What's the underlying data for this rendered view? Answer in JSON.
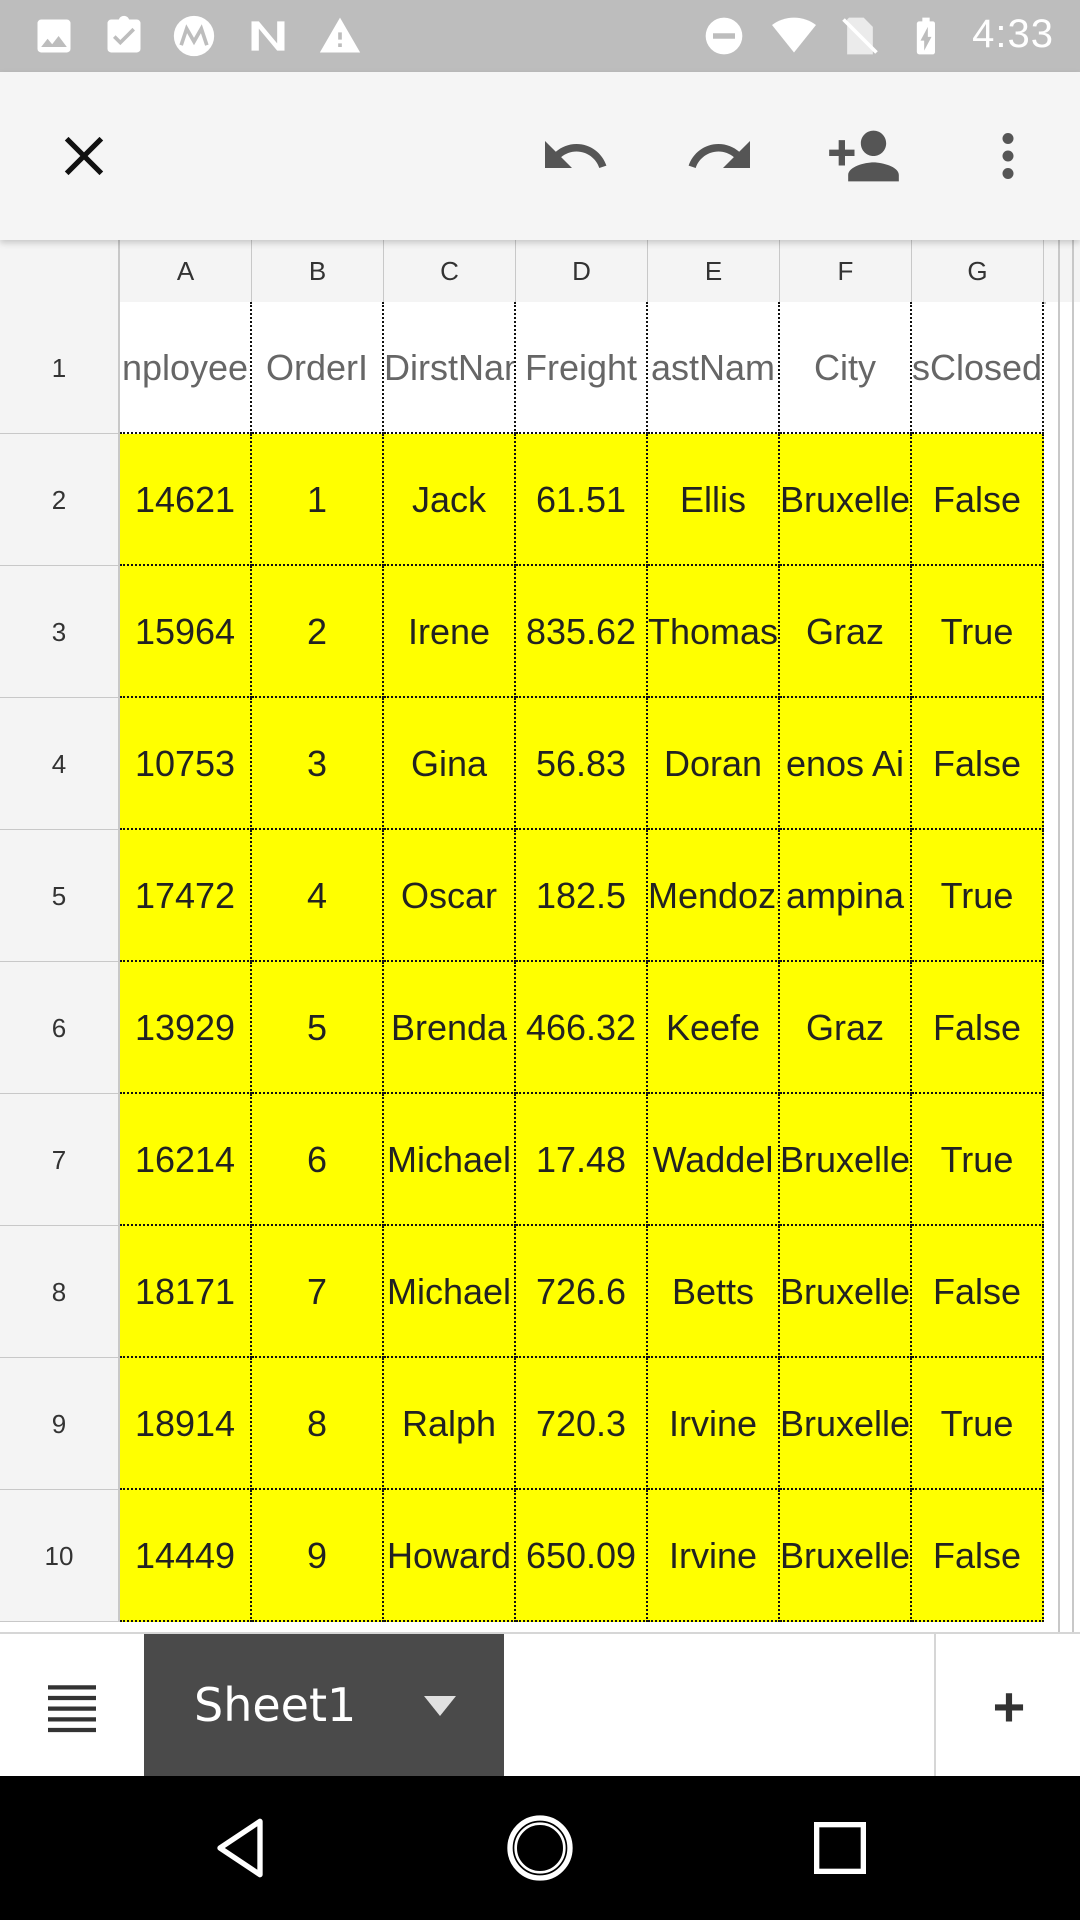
{
  "status_bar": {
    "time": "4:33",
    "left_icons": [
      "photo-icon",
      "clipboard-check-icon",
      "motorola-icon",
      "n-icon",
      "warning-icon"
    ],
    "right_icons": [
      "do-not-disturb-icon",
      "wifi-icon",
      "no-sim-icon",
      "battery-charging-icon"
    ]
  },
  "toolbar": {
    "icons": [
      "close-icon",
      "undo-icon",
      "redo-icon",
      "add-person-icon",
      "more-vert-icon"
    ]
  },
  "columns": [
    "A",
    "B",
    "C",
    "D",
    "E",
    "F",
    "G"
  ],
  "row_numbers": [
    "1",
    "2",
    "3",
    "4",
    "5",
    "6",
    "7",
    "8",
    "9",
    "10"
  ],
  "header_row": [
    "nployee",
    "OrderI",
    "DirstNam",
    "Freight",
    "astNam",
    "City",
    "sClosed"
  ],
  "rows": [
    [
      "14621",
      "1",
      "Jack",
      "61.51",
      "Ellis",
      "Bruxelles",
      "False"
    ],
    [
      "15964",
      "2",
      "Irene",
      "835.62",
      "Thomas",
      "Graz",
      "True"
    ],
    [
      "10753",
      "3",
      "Gina",
      "56.83",
      "Doran",
      "enos Ai",
      "False"
    ],
    [
      "17472",
      "4",
      "Oscar",
      "182.5",
      "Mendoza",
      "ampina",
      "True"
    ],
    [
      "13929",
      "5",
      "Brenda",
      "466.32",
      "Keefe",
      "Graz",
      "False"
    ],
    [
      "16214",
      "6",
      "Michael",
      "17.48",
      "Waddel",
      "Bruxelles",
      "True"
    ],
    [
      "18171",
      "7",
      "Michael",
      "726.6",
      "Betts",
      "Bruxelles",
      "False"
    ],
    [
      "18914",
      "8",
      "Ralph",
      "720.3",
      "Irvine",
      "Bruxelles",
      "True"
    ],
    [
      "14449",
      "9",
      "Howard",
      "650.09",
      "Irvine",
      "Bruxelles",
      "False"
    ]
  ],
  "sheet_bar": {
    "active_sheet": "Sheet1",
    "add_label": "+"
  },
  "colors": {
    "highlight": "#ffff00",
    "status_bar": "#bdbdbd",
    "toolbar": "#f5f5f5",
    "sheet_tab": "#4a4a4a"
  }
}
